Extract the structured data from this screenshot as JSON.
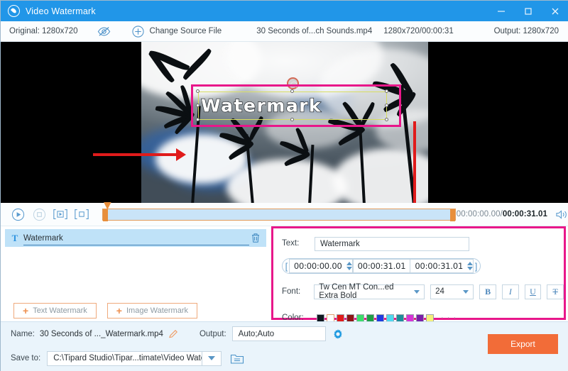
{
  "window": {
    "title": "Video Watermark",
    "logo_icon": "droplet-logo-icon",
    "minimize_icon": "minimize-icon",
    "maximize_icon": "maximize-icon",
    "close_icon": "close-icon"
  },
  "toolbar": {
    "original_label": "Original: 1280x720",
    "eye_icon": "eye-off-icon",
    "plus_icon": "plus-circle-icon",
    "change_source_label": "Change Source File",
    "file_name": "30 Seconds of...ch Sounds.mp4",
    "file_resolution": "1280x720/00:00:31",
    "output_label": "Output: 1280x720"
  },
  "preview": {
    "watermark_text": "Watermark",
    "rotate_handle_icon": "rotate-handle-icon",
    "annotation_box_color": "#e8178a",
    "annotation_arrow_color": "#e01b1b",
    "selection_color": "#d8dd61"
  },
  "player": {
    "play_icon": "play-circle-icon",
    "stop_icon": "stop-circle-icon",
    "snapshot_play_icon": "bracket-play-icon",
    "snapshot_stop_icon": "bracket-stop-icon",
    "current_time": "00:00:00.00",
    "separator": "/",
    "total_time": "00:00:31.01",
    "volume_icon": "speaker-icon"
  },
  "layers": {
    "items": [
      {
        "type_icon": "text-type-icon",
        "name": "Watermark",
        "delete_icon": "trash-icon"
      }
    ],
    "add_text_label": "Text Watermark",
    "add_image_label": "Image Watermark",
    "plus_glyph": "+"
  },
  "properties": {
    "text_label": "Text:",
    "text_value": "Watermark",
    "time_open_bracket": "[",
    "time_close_bracket": "]",
    "time_start": "00:00:00.00",
    "time_end": "00:00:31.01",
    "time_duration": "00:00:31.01",
    "font_label": "Font:",
    "font_family_value": "Tw Cen MT Con...ed Extra Bold",
    "font_size_value": "24",
    "bold_label": "B",
    "italic_label": "I",
    "underline_label": "U",
    "strike_label": "T",
    "color_label": "Color:",
    "colors": [
      "#101820",
      "#ffffff",
      "#e01b1b",
      "#8f1515",
      "#3ddb6b",
      "#1f9e46",
      "#1f3ce0",
      "#4fd8ee",
      "#1f8d9a",
      "#d633d6",
      "#7a1fa8",
      "#f4f07a"
    ],
    "more_colors_glyph": "· · ·"
  },
  "bottom": {
    "name_label": "Name:",
    "name_value": "30 Seconds of ..._Watermark.mp4",
    "edit_icon": "pencil-icon",
    "output_label": "Output:",
    "output_value": "Auto;Auto",
    "settings_icon": "gear-icon",
    "save_to_label": "Save to:",
    "save_to_value": "C:\\Tipard Studio\\Tipar...timate\\Video Watermark",
    "folder_icon": "folder-icon",
    "dropdown_icon": "chevron-down-icon",
    "export_label": "Export",
    "export_color": "#f26c38"
  }
}
